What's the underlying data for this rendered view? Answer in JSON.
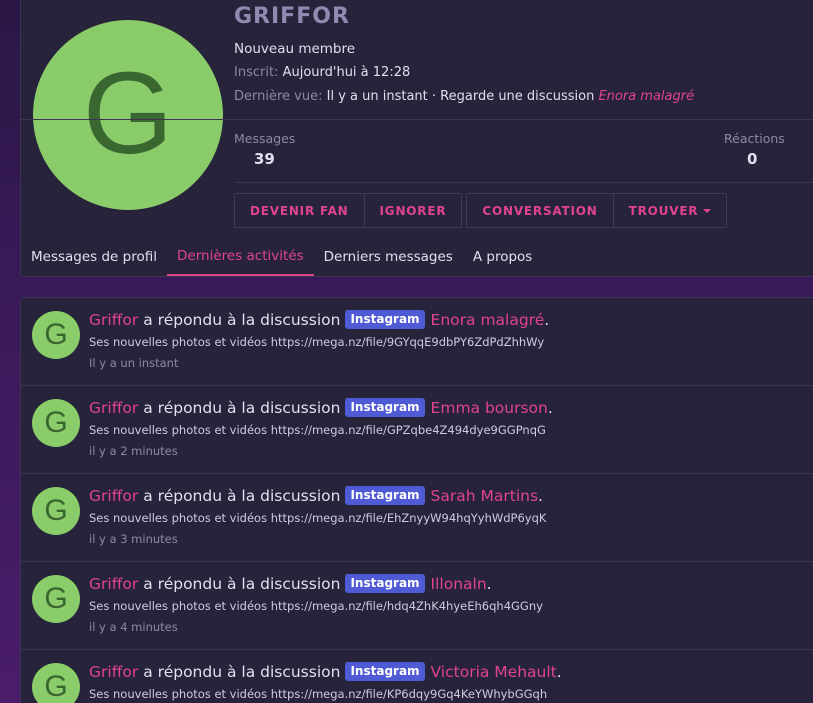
{
  "profile": {
    "avatar_letter": "G",
    "username": "GRIFFOR",
    "user_title": "Nouveau membre",
    "joined_label": "Inscrit:",
    "joined_value": "Aujourd'hui à 12:28",
    "last_seen_label": "Dernière vue:",
    "last_seen_value": "Il y a un instant · Regarde une discussion",
    "last_seen_thread": "Enora malagré",
    "stats": {
      "messages_label": "Messages",
      "messages_value": "39",
      "reactions_label": "Réactions",
      "reactions_value": "0"
    },
    "actions": {
      "fan": "DEVENIR FAN",
      "ignore": "IGNORER",
      "conversation": "CONVERSATION",
      "find": "TROUVER"
    },
    "tabs": [
      {
        "label": "Messages de profil"
      },
      {
        "label": "Dernières activités"
      },
      {
        "label": "Derniers messages"
      },
      {
        "label": "A propos"
      }
    ]
  },
  "activities": [
    {
      "avatar_letter": "G",
      "user": "Griffor",
      "action": "a répondu à la discussion",
      "prefix": "Instagram",
      "thread": "Enora malagré",
      "dot": ".",
      "snippet": "Ses nouvelles photos et vidéos https://mega.nz/file/9GYqqE9dbPY6ZdPdZhhWy",
      "time": "Il y a un instant"
    },
    {
      "avatar_letter": "G",
      "user": "Griffor",
      "action": "a répondu à la discussion",
      "prefix": "Instagram",
      "thread": "Emma bourson",
      "dot": ".",
      "snippet": "Ses nouvelles photos et vidéos https://mega.nz/file/GPZqbe4Z494dye9GGPnqG",
      "time": "il y a 2 minutes"
    },
    {
      "avatar_letter": "G",
      "user": "Griffor",
      "action": "a répondu à la discussion",
      "prefix": "Instagram",
      "thread": "Sarah Martins",
      "dot": ".",
      "snippet": "Ses nouvelles photos et vidéos https://mega.nz/file/EhZnyyW94hqYyhWdP6yqK",
      "time": "il y a 3 minutes"
    },
    {
      "avatar_letter": "G",
      "user": "Griffor",
      "action": "a répondu à la discussion",
      "prefix": "Instagram",
      "thread": "Illonaln",
      "dot": ".",
      "snippet": "Ses nouvelles photos et vidéos https://mega.nz/file/hdq4ZhK4hyeEh6qh4GGny",
      "time": "il y a 4 minutes"
    },
    {
      "avatar_letter": "G",
      "user": "Griffor",
      "action": "a répondu à la discussion",
      "prefix": "Instagram",
      "thread": "Victoria Mehault",
      "dot": ".",
      "snippet": "Ses nouvelles photos et vidéos https://mega.nz/file/KP6dqy9Gq4KeYWhybGGqh",
      "time": ""
    }
  ]
}
